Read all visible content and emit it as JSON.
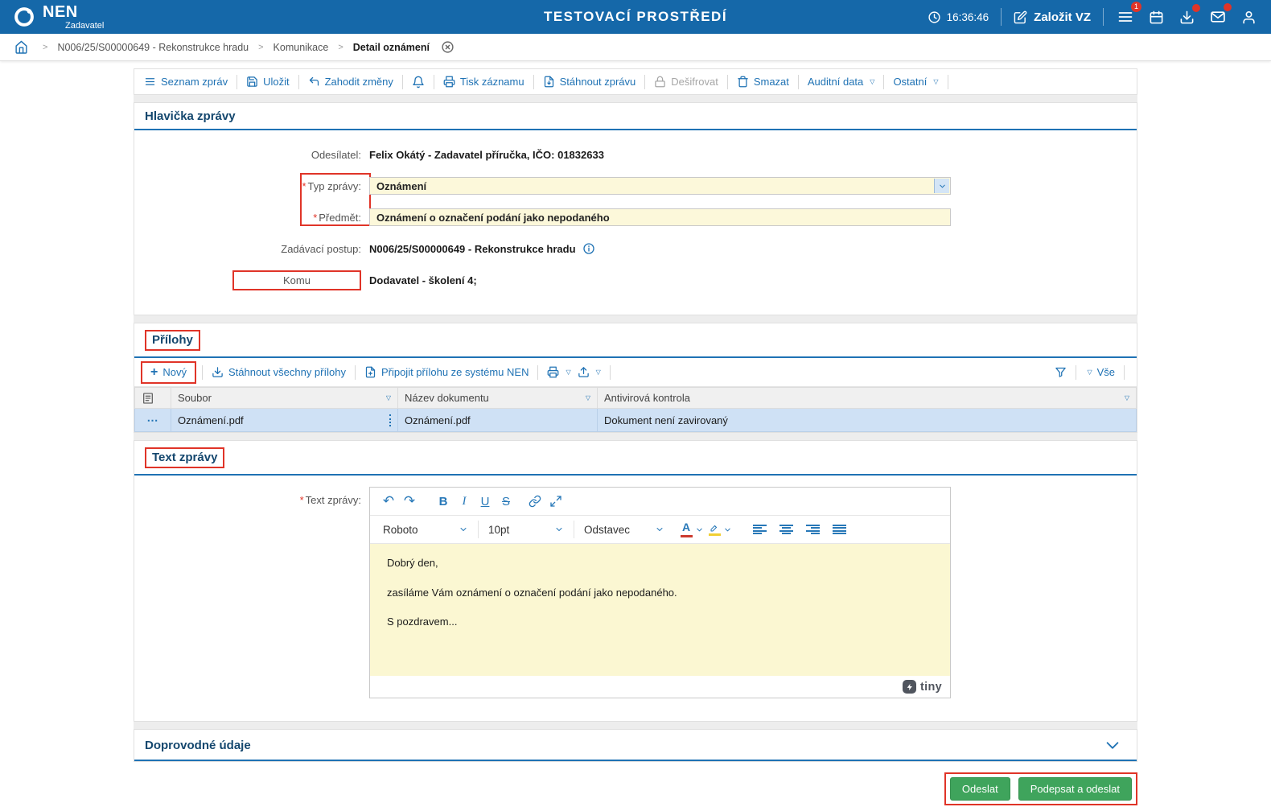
{
  "topbar": {
    "brand": "NEN",
    "brand_sub": "Zadavatel",
    "title": "TESTOVACÍ PROSTŘEDÍ",
    "time": "16:36:46",
    "create_vz": "Založit VZ",
    "menu_badge": "1"
  },
  "breadcrumb": {
    "items": [
      "N006/25/S00000649 - Rekonstrukce hradu",
      "Komunikace",
      "Detail oznámení"
    ]
  },
  "toolbar": {
    "seznam": "Seznam zpráv",
    "ulozit": "Uložit",
    "zahodit": "Zahodit změny",
    "tisk": "Tisk záznamu",
    "stahnout": "Stáhnout zprávu",
    "desifrovat": "Dešifrovat",
    "smazat": "Smazat",
    "auditni": "Auditní data",
    "ostatni": "Ostatní"
  },
  "header": {
    "title": "Hlavička zprávy",
    "sender_label": "Odesílatel:",
    "sender_value": "Felix Okátý - Zadavatel příručka, IČO: 01832633",
    "type_label": "Typ zprávy:",
    "type_value": "Oznámení",
    "subject_label": "Předmět:",
    "subject_value": "Oznámení o označení podání jako nepodaného",
    "procedure_label": "Zadávací postup:",
    "procedure_value": "N006/25/S00000649 - Rekonstrukce hradu",
    "to_label": "Komu",
    "to_value": "Dodavatel - školení 4;"
  },
  "attachments": {
    "title": "Přílohy",
    "new_label": "Nový",
    "download_all": "Stáhnout všechny přílohy",
    "attach_nen": "Připojit přílohu ze systému NEN",
    "all_label": "Vše",
    "col_file": "Soubor",
    "col_doc": "Název dokumentu",
    "col_antivirus": "Antivirová kontrola",
    "row": {
      "file": "Oznámení.pdf",
      "doc": "Oznámení.pdf",
      "antivirus": "Dokument není zavirovaný"
    }
  },
  "message": {
    "title": "Text zprávy",
    "field_label": "Text zprávy:",
    "editor": {
      "font": "Roboto",
      "size": "10pt",
      "paragraph": "Odstavec",
      "bold": "B",
      "italic": "I",
      "underline": "U",
      "strike": "S",
      "line1": "Dobrý den,",
      "line2": "zasíláme Vám oznámení o označení podání jako nepodaného.",
      "line3": "S pozdravem...",
      "brand": "tiny"
    }
  },
  "extra": {
    "title": "Doprovodné údaje"
  },
  "actions": {
    "send": "Odeslat",
    "sign_send": "Podepsat a odeslat"
  },
  "misc": {
    "asterisk": "*"
  },
  "icons": {
    "sep": ">",
    "caret": "▽",
    "plus": "+",
    "undo": "↶",
    "redo": "↷",
    "dots": "⋯"
  },
  "colors": {
    "topbar_blue": "#1568a9",
    "accent_blue": "#1f72b4",
    "section_navy": "#14476e",
    "required_yellow": "#fcf8da",
    "editor_yellow": "#fbf7d2",
    "selected_row": "#cfe1f5",
    "green_button": "#3fa45c",
    "annotation_red": "#e03428",
    "badge_red": "#e03428"
  }
}
